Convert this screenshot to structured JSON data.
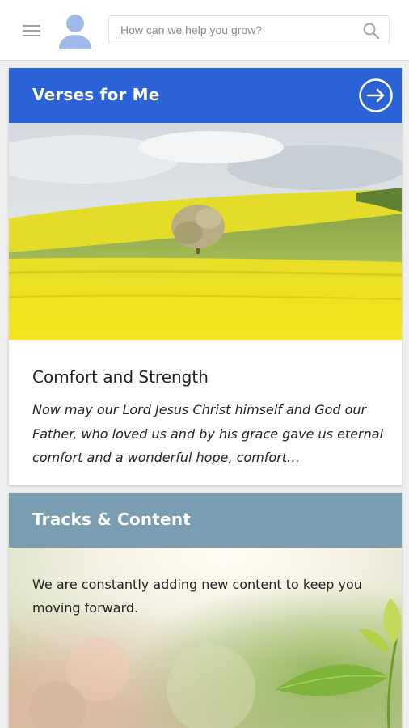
{
  "header": {
    "menu_icon": "hamburger-menu-icon",
    "avatar_icon": "user-avatar-icon",
    "search": {
      "placeholder": "How can we help you grow?",
      "value": "",
      "icon": "search-icon"
    }
  },
  "verses_card": {
    "title": "Verses for Me",
    "action_icon": "arrow-right-circle-icon",
    "header_color": "#2b62d6",
    "verse_title": "Comfort and Strength",
    "verse_text": "Now may our Lord Jesus Christ himself and God our Father, who loved us and by his grace gave us eternal comfort and a wonderful hope, comfort…"
  },
  "tracks_card": {
    "title": "Tracks & Content",
    "header_color": "#7a9eb1",
    "description": "We are constantly adding new content to keep you moving forward."
  }
}
